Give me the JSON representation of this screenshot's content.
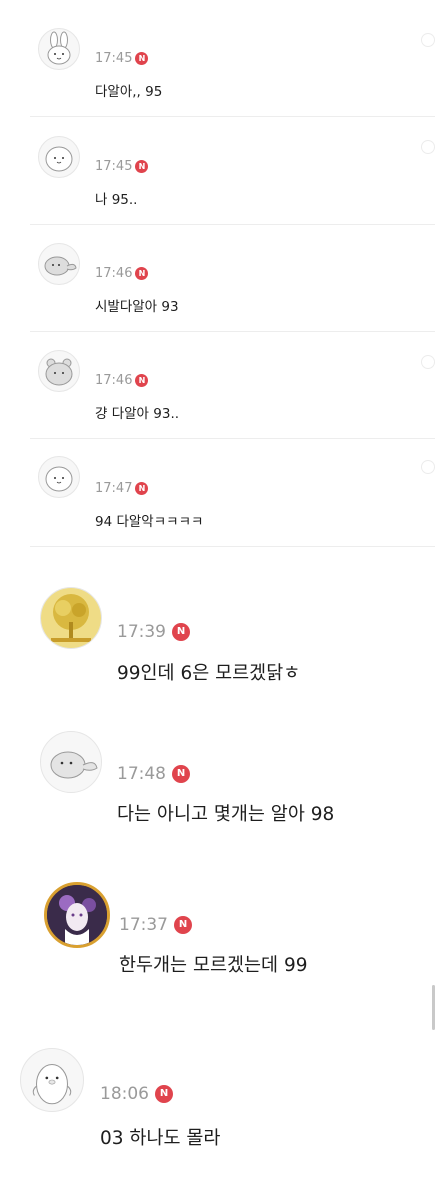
{
  "badge_letter": "N",
  "comments": [
    {
      "time": "17:45",
      "text": "다알아,, 95",
      "avatar": "bunny-avatar-icon"
    },
    {
      "time": "17:45",
      "text": "나 95..",
      "avatar": "blob-avatar-icon"
    },
    {
      "time": "17:46",
      "text": "시발다알아 93",
      "avatar": "seal-avatar-icon"
    },
    {
      "time": "17:46",
      "text": "걍 다알아 93..",
      "avatar": "hamster-avatar-icon"
    },
    {
      "time": "17:47",
      "text": "94 다알악ㅋㅋㅋㅋ",
      "avatar": "blob-avatar-icon"
    },
    {
      "time": "17:39",
      "text": "99인데 6은 모르겠닭ㅎ",
      "avatar": "golden-tree-avatar-icon"
    },
    {
      "time": "17:48",
      "text": "다는 아니고 몇개는 알아 98",
      "avatar": "seal-avatar-icon"
    },
    {
      "time": "17:37",
      "text": "한두개는 모르겠는데 99",
      "avatar": "anime-girl-avatar-icon"
    },
    {
      "time": "18:06",
      "text": "03 하나도 몰라",
      "avatar": "penguin-avatar-icon"
    }
  ]
}
